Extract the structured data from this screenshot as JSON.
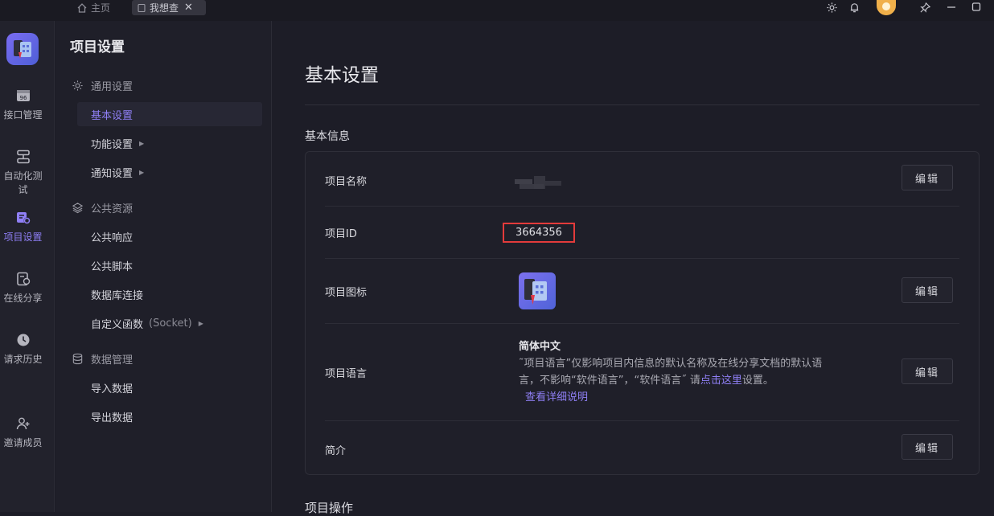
{
  "topbar": {
    "home_tab": "主页",
    "active_tab": "我想查",
    "close_glyph": "✕",
    "icons": [
      "settings-icon",
      "bell-icon",
      "avatar",
      "pin-icon",
      "minimize-icon",
      "maximize-icon"
    ]
  },
  "rail": {
    "items": [
      {
        "label": "接口管理",
        "icon": "api-icon"
      },
      {
        "label": "自动化测试",
        "icon": "automation-icon"
      },
      {
        "label": "项目设置",
        "icon": "project-settings-icon",
        "active": true
      },
      {
        "label": "在线分享",
        "icon": "share-icon"
      },
      {
        "label": "请求历史",
        "icon": "history-icon"
      },
      {
        "label": "邀请成员",
        "icon": "invite-icon"
      }
    ]
  },
  "nav": {
    "title": "项目设置",
    "groups": [
      {
        "label": "通用设置",
        "items": [
          {
            "label": "基本设置",
            "selected": true
          },
          {
            "label": "功能设置",
            "has_children": true
          },
          {
            "label": "通知设置",
            "has_children": true
          }
        ]
      },
      {
        "label": "公共资源",
        "items": [
          {
            "label": "公共响应"
          },
          {
            "label": "公共脚本"
          },
          {
            "label": "数据库连接"
          },
          {
            "label": "自定义函数",
            "sub": "(Socket)",
            "has_children": true
          }
        ]
      },
      {
        "label": "数据管理",
        "items": [
          {
            "label": "导入数据"
          },
          {
            "label": "导出数据"
          }
        ]
      }
    ]
  },
  "main": {
    "page_title": "基本设置",
    "basic_info_title": "基本信息",
    "edit_label": "编辑",
    "rows": {
      "name": {
        "label": "项目名称"
      },
      "id": {
        "label": "项目ID",
        "value": "3664356"
      },
      "icon": {
        "label": "项目图标"
      },
      "language": {
        "label": "项目语言",
        "value": "简体中文",
        "desc_1": "˜项目语言”仅影响项目内信息的默认名称及在线分享文档的默认语",
        "desc_2a": "言，不影响“软件语言”，“软件语言˝ 请",
        "desc_link": "点击这里",
        "desc_2b": "设置。",
        "detail_link": "查看详细说明"
      },
      "intro": {
        "label": "简介"
      }
    },
    "project_ops_title": "项目操作"
  },
  "colors": {
    "accent": "#8f7ff5",
    "highlight_border": "#e33b3b",
    "background": "#1d1d27"
  }
}
